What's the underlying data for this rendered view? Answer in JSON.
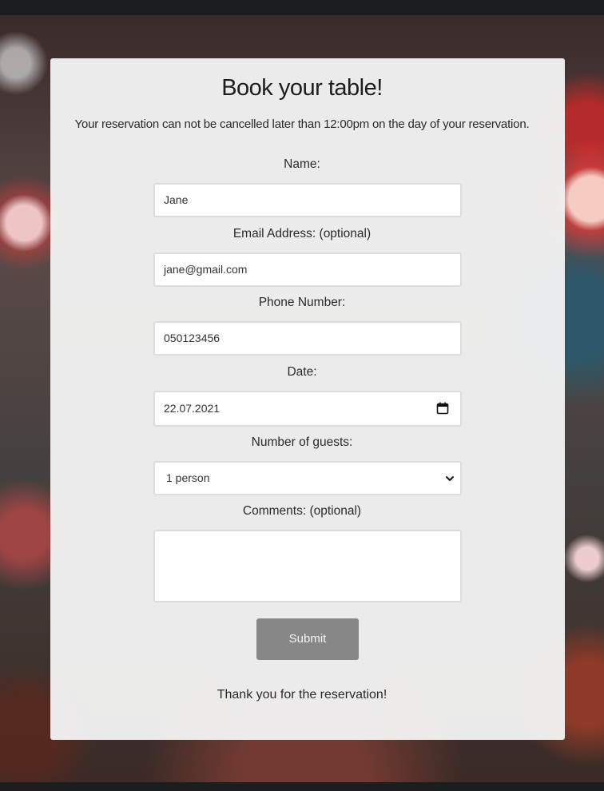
{
  "form": {
    "title": "Book your table!",
    "note": "Your reservation can not be cancelled later than 12:00pm on the day of your reservation.",
    "name_label": "Name:",
    "name_value": "Jane",
    "email_label": "Email Address: (optional)",
    "email_value": "jane@gmail.com",
    "phone_label": "Phone Number:",
    "phone_value": "050123456",
    "date_label": "Date:",
    "date_value": "22.07.2021",
    "guests_label": "Number of guests:",
    "guests_selected": "1 person",
    "comments_label": "Comments: (optional)",
    "comments_value": "",
    "submit_label": "Submit",
    "thanks_message": "Thank you for the reservation!"
  },
  "icons": {
    "date": "calendar-icon",
    "select": "chevron-down-icon"
  },
  "colors": {
    "card_background": "#f2f2f2",
    "submit_button": "#878787",
    "field_border": "#dcdcdc",
    "page_bar": "#1c1d1f"
  }
}
